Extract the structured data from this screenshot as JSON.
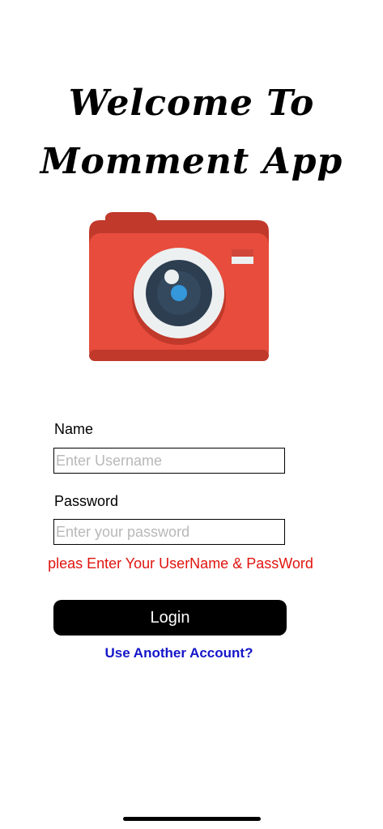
{
  "app": {
    "title_line1": "Welcome To",
    "title_line2": "Momment App"
  },
  "logo": {
    "icon": "camera-icon",
    "colors": {
      "body": "#e74c3c",
      "top_band": "#cf3f33",
      "lens_ring": "#ecf0f1",
      "lens_dark": "#2c3e50",
      "lens_accent": "#3498db"
    }
  },
  "form": {
    "name_label": "Name",
    "name_placeholder": "Enter Username",
    "password_label": "Password",
    "password_placeholder": "Enter your password",
    "error_message": "pleas Enter Your UserName & PassWord",
    "login_label": "Login",
    "alt_account_label": "Use Another Account?"
  }
}
